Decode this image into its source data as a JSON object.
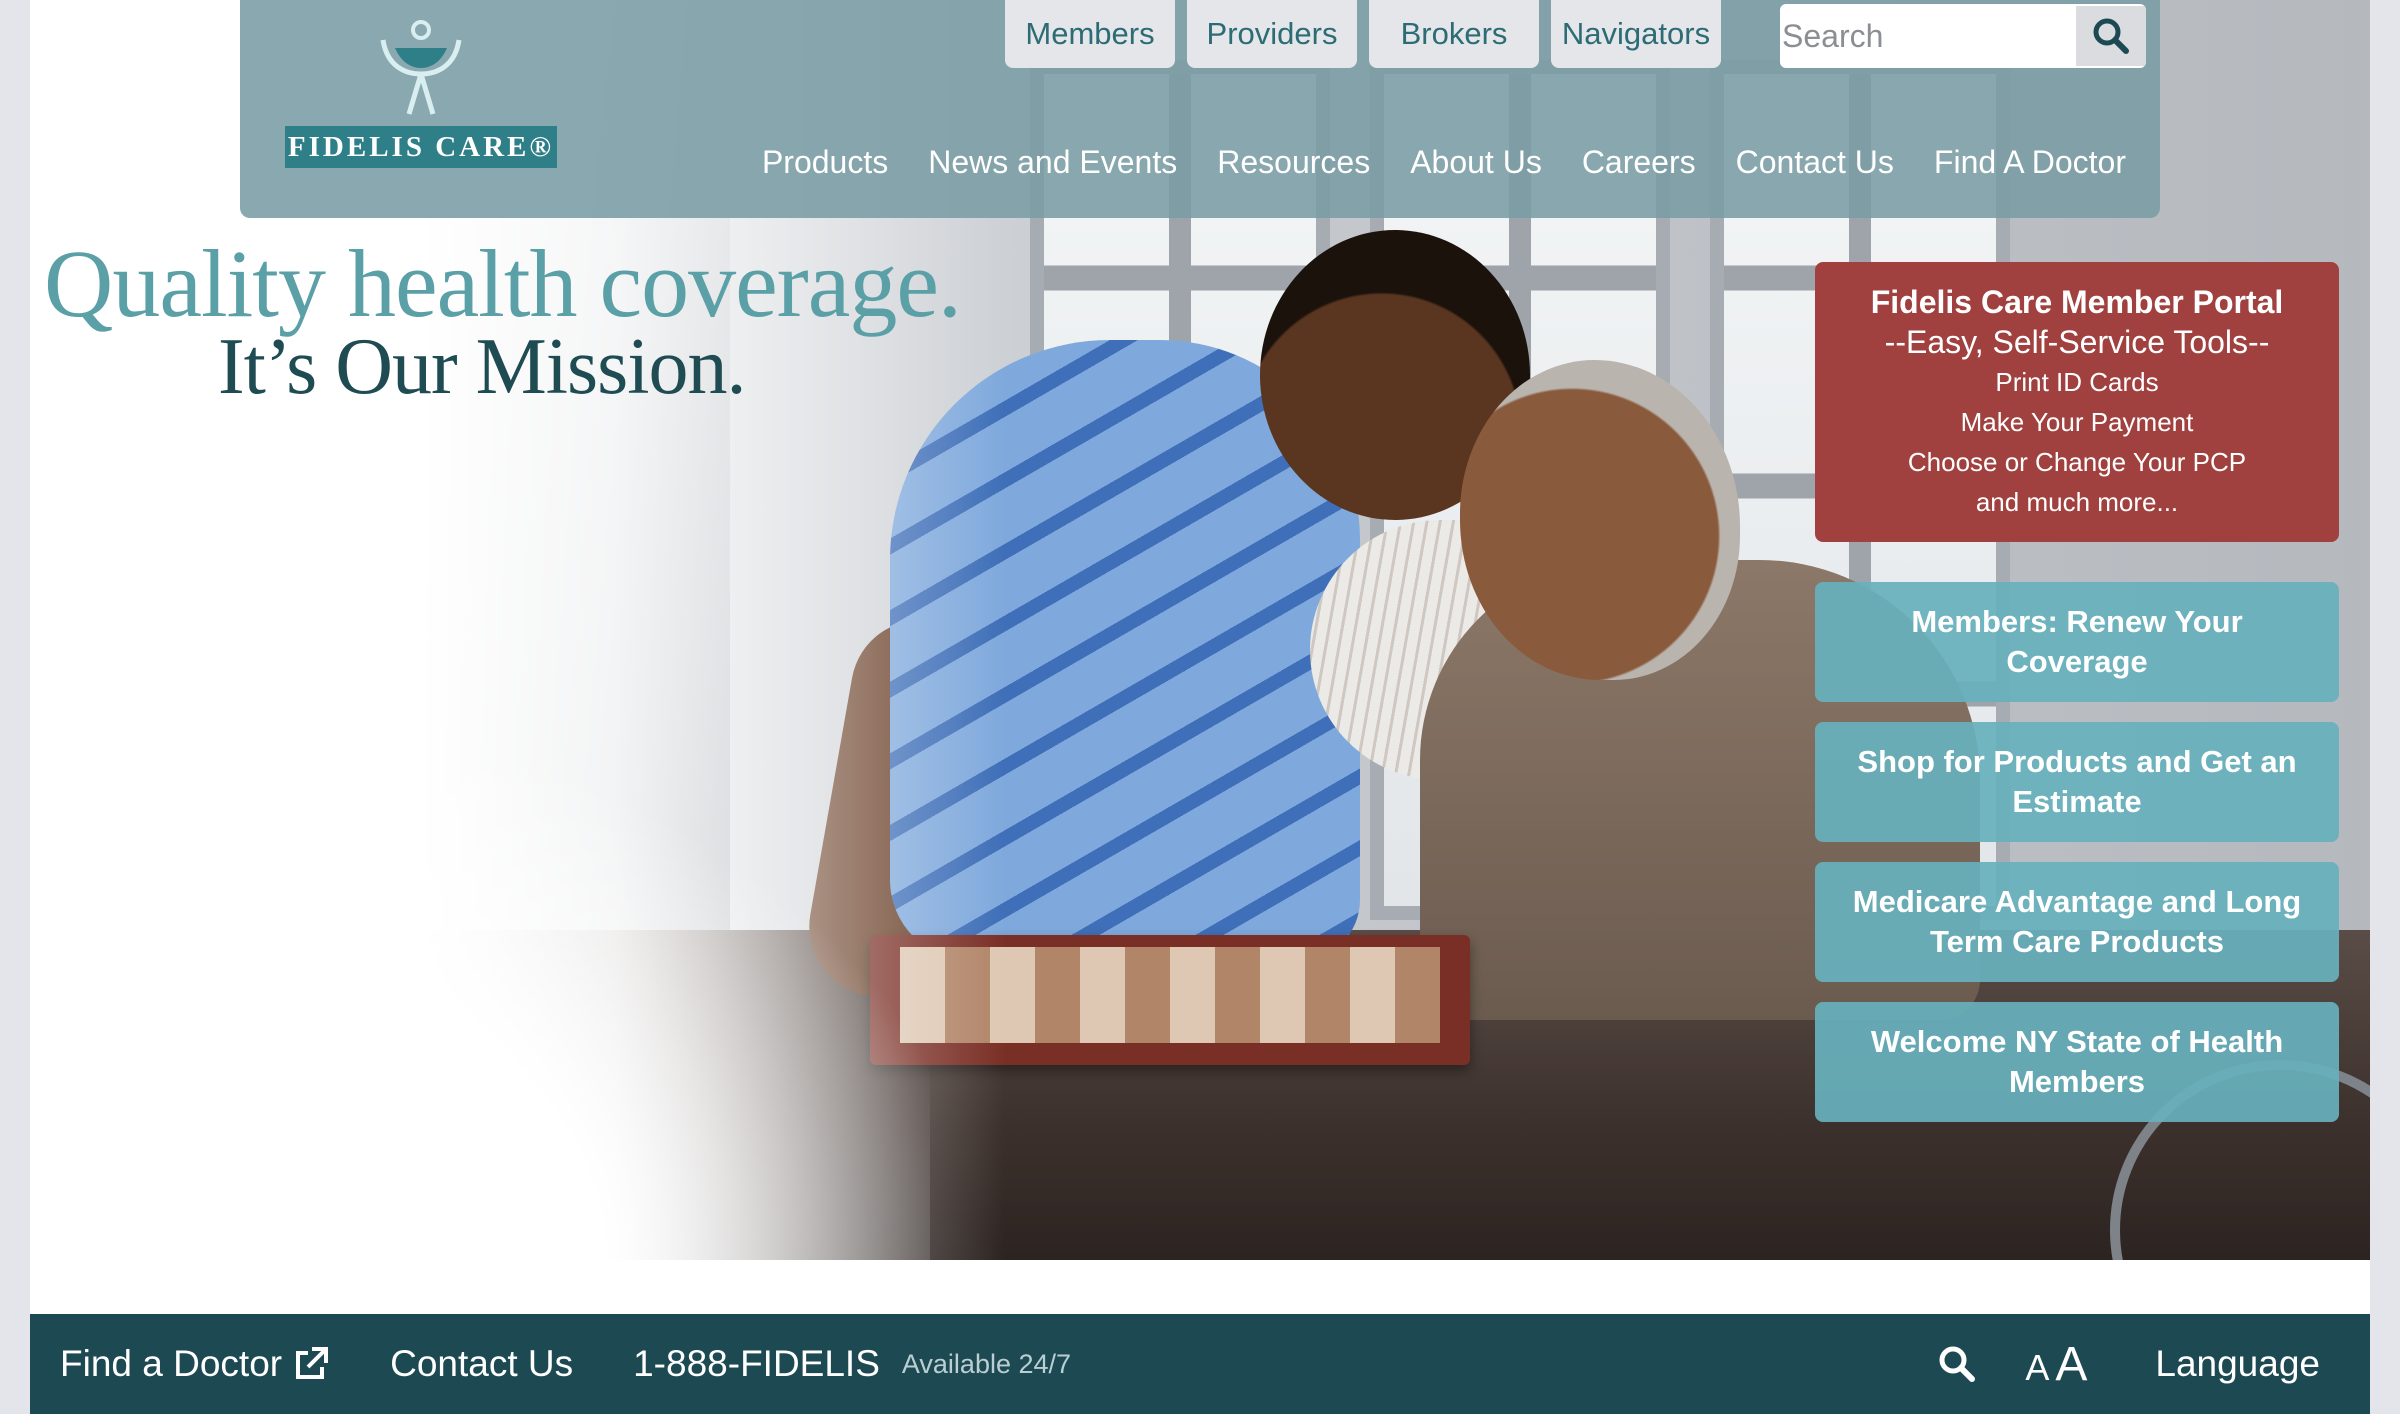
{
  "brand": {
    "name": "Fidelis Care",
    "wordmark": "FIDELIS CARE®"
  },
  "topnav": [
    "Members",
    "Providers",
    "Brokers",
    "Navigators"
  ],
  "search": {
    "placeholder": "Search"
  },
  "mainnav": [
    "Products",
    "News and Events",
    "Resources",
    "About Us",
    "Careers",
    "Contact Us",
    "Find A Doctor"
  ],
  "tagline": {
    "line1": "Quality health coverage.",
    "line2": "It’s Our Mission."
  },
  "portal": {
    "title": "Fidelis Care Member Portal",
    "subtitle": "--Easy, Self-Service Tools--",
    "lines": [
      "Print ID Cards",
      "Make Your Payment",
      "Choose or Change Your PCP",
      "and much more..."
    ]
  },
  "cta": [
    "Members: Renew Your Coverage",
    "Shop for Products and Get an Estimate",
    "Medicare Advantage and Long Term Care Products",
    "Welcome NY State of Health Members"
  ],
  "footer": {
    "find_doctor": "Find a Doctor",
    "contact": "Contact Us",
    "phone": "1-888-FIDELIS",
    "availability": "Available 24/7",
    "text_size_small": "A",
    "text_size_large": "A",
    "language": "Language"
  },
  "colors": {
    "header_bg": "#7a9ca4",
    "teal_dark": "#1d4a52",
    "portal_red": "#a0413f",
    "cta_teal": "#67b0bc",
    "tagline_light": "#5aa0a6",
    "tagline_dark": "#1f4b52"
  },
  "icons": {
    "search": "magnifier-icon",
    "external_link": "external-link-icon",
    "logo": "fidelis-figure-logo"
  }
}
